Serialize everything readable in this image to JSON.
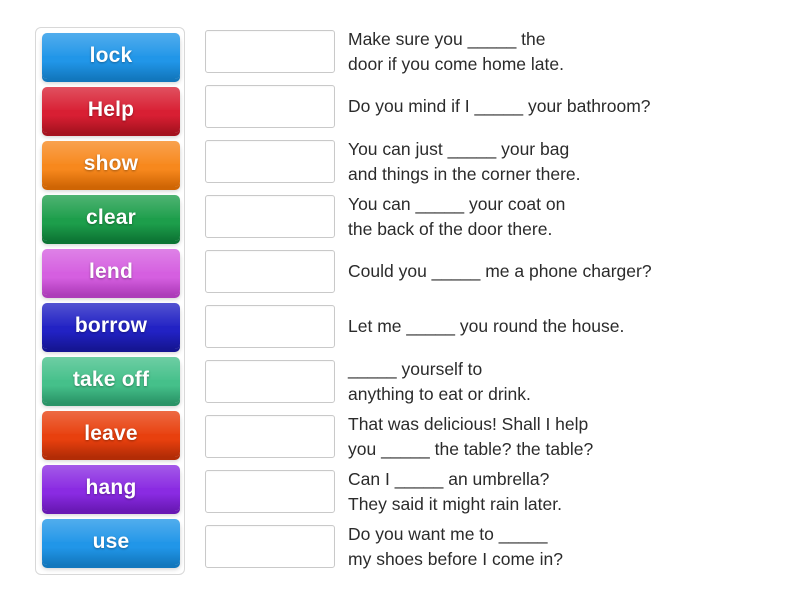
{
  "activity": {
    "type": "match-up-word-tiles",
    "tile_count": 10,
    "row_count": 10
  },
  "tiles": [
    {
      "label": "lock",
      "color": "#2196e8",
      "color_dark": "#1277bd"
    },
    {
      "label": "Help",
      "color": "#d81f33",
      "color_dark": "#a5121f"
    },
    {
      "label": "show",
      "color": "#f7881d",
      "color_dark": "#cf6504"
    },
    {
      "label": "clear",
      "color": "#1d9e4b",
      "color_dark": "#0d7434"
    },
    {
      "label": "lend",
      "color": "#d55fe0",
      "color_dark": "#ad3bb9"
    },
    {
      "label": "borrow",
      "color": "#2222c4",
      "color_dark": "#151593"
    },
    {
      "label": "take off",
      "color": "#45c08a",
      "color_dark": "#2a9467"
    },
    {
      "label": "leave",
      "color": "#e8400e",
      "color_dark": "#b22c06"
    },
    {
      "label": "hang",
      "color": "#8a2be2",
      "color_dark": "#6818b4"
    },
    {
      "label": "use",
      "color": "#2196e8",
      "color_dark": "#1277bd"
    }
  ],
  "rows": [
    {
      "answer": "",
      "placeholder": "",
      "sentence": "Make sure you _____ the\ndoor if you come home late."
    },
    {
      "answer": "",
      "placeholder": "",
      "sentence": "Do you mind if I _____ your bathroom?"
    },
    {
      "answer": "",
      "placeholder": "",
      "sentence": "You can just _____ your bag\nand things in the corner there."
    },
    {
      "answer": "",
      "placeholder": "",
      "sentence": "You can _____ your coat on\nthe back of the door there."
    },
    {
      "answer": "",
      "placeholder": "",
      "sentence": "Could you _____ me a phone charger?"
    },
    {
      "answer": "",
      "placeholder": "",
      "sentence": "Let me _____ you round the house."
    },
    {
      "answer": "",
      "placeholder": "",
      "sentence": "_____ yourself to\nanything to eat or drink."
    },
    {
      "answer": "",
      "placeholder": "",
      "sentence": "That was delicious! Shall I help\nyou _____ the table? the table?"
    },
    {
      "answer": "",
      "placeholder": "",
      "sentence": "Can I _____ an umbrella?\nThey said it might rain later."
    },
    {
      "answer": "",
      "placeholder": "",
      "sentence": "Do you want me to _____\nmy shoes before I come in?"
    }
  ],
  "colors": {
    "page_background": "#ffffff",
    "panel_border": "#d8d8d8",
    "box_border": "#c9c9c9",
    "text": "#2b2b2b",
    "tile_text": "#ffffff"
  }
}
